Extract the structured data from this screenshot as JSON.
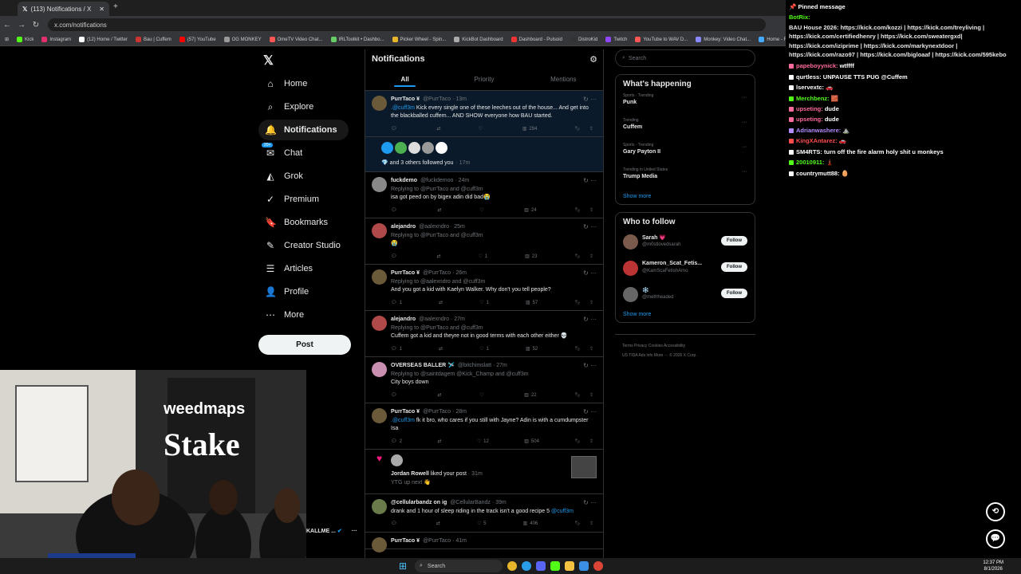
{
  "browser": {
    "tab_title": "(113) Notifications / X",
    "url": "x.com/notifications",
    "bookmarks": [
      "Kick",
      "Instagram",
      "(12) Home / Twitter",
      "Bau | Cuffem",
      "(57) YouTube",
      "OG MONKEY",
      "OmeTV Video Chat...",
      "IRLToolkit • Dashbo...",
      "Picker Wheel - Spin...",
      "KickBot Dashboard",
      "Dashboard - Pulsoid",
      "DistroKid",
      "Twitch",
      "YouTube to WAV D...",
      "Monkey: Video Chat...",
      "Home - Rob"
    ]
  },
  "nav": {
    "items": [
      "Home",
      "Explore",
      "Notifications",
      "Chat",
      "Grok",
      "Premium",
      "Bookmarks",
      "Creator Studio",
      "Articles",
      "Profile",
      "More"
    ],
    "chat_badge": "20+",
    "post_label": "Post"
  },
  "main": {
    "title": "Notifications",
    "tabs": [
      "All",
      "Priority",
      "Mentions"
    ],
    "posts": [
      {
        "name": "PurrTaco ¥",
        "handle": "@PurrTaco · 13m",
        "mention": ".@cuff3m",
        "text": " Kick every single one of these leeches out of the house... And get into the blackballed cuffem... AND SHOW everyone how BAU started.",
        "likes": "",
        "views": "284",
        "replies": "",
        "color": "#6b5a3a"
      },
      {
        "name": "fuckdemo",
        "handle": "@fuckdemoo · 24m",
        "reply_to": "Replying to @PurrTaco and @cuff3m",
        "text": "isa got peed on by bigex adin did bad😭",
        "likes": "",
        "views": "24",
        "replies": "",
        "color": "#888"
      },
      {
        "name": "alejandro",
        "handle": "@aalexndro · 25m",
        "reply_to": "Replying to @PurrTaco and @cuff3m",
        "text": "😭",
        "likes": "1",
        "views": "23",
        "replies": "",
        "color": "#b04a4a"
      },
      {
        "name": "PurrTaco ¥",
        "handle": "@PurrTaco · 26m",
        "reply_to": "Replying to @aalexndro and @cuff3m",
        "text": "And you got a kid with Kaelyn Walker. Why don't you tell people?",
        "likes": "1",
        "views": "57",
        "replies": "1",
        "color": "#6b5a3a"
      },
      {
        "name": "alejandro",
        "handle": "@aalexndro · 27m",
        "reply_to": "Replying to @PurrTaco and @cuff3m",
        "text": "Cuffem got a kid and theyre not in good terms with each other either 💀",
        "likes": "1",
        "views": "52",
        "replies": "1",
        "color": "#b04a4a"
      },
      {
        "name": "OVERSEAS BALLER 🛩️",
        "handle": "@bitchimslatt · 27m",
        "reply_to": "Replying to @saintdagem @Kick_Champ and @cuff3m",
        "text": "City boys down",
        "likes": "",
        "views": "22",
        "replies": "",
        "color": "#c98fb0"
      },
      {
        "name": "PurrTaco ¥",
        "handle": "@PurrTaco · 28m",
        "mention": ".@cuff3m",
        "text": " fk it bro, who cares if you still with Jayne? Adin is with a cumdumpster Isa",
        "likes": "12",
        "views": "504",
        "replies": "2",
        "color": "#6b5a3a"
      }
    ],
    "follow_notice": "and 3 others followed you",
    "follow_time": "· 17m",
    "like_notice_name": "Jordan Rowell",
    "like_notice_text": " liked your post",
    "like_notice_time": " · 31m",
    "like_notice_post": "YTG up next 👋",
    "last_post": {
      "name": "@cellularbandz on ig",
      "handle": "@CellularBandz · 39m",
      "text": "drank and 1 hour of sleep riding in the track isn't a good recipe 5 ",
      "mention": "@cuff3m",
      "likes": "5",
      "views": "406"
    },
    "cut_post": {
      "name": "PurrTaco ¥",
      "handle": "@PurrTaco · 41m"
    }
  },
  "right": {
    "search_placeholder": "Search",
    "whats_happening": "What's happening",
    "trends": [
      {
        "category": "Sports · Trending",
        "topic": "Punk"
      },
      {
        "category": "Trending",
        "topic": "Cuffem"
      },
      {
        "category": "Sports · Trending",
        "topic": "Gary Payton II"
      },
      {
        "category": "Trending in United States",
        "topic": "Trump Media"
      }
    ],
    "show_more": "Show more",
    "who_to_follow": "Who to follow",
    "follow_suggestions": [
      {
        "name": "Sarah 💗",
        "handle": "@m0stlovedsarah"
      },
      {
        "name": "Kameron_Scat_Fetis...",
        "handle": "@KamScaFetishAmo"
      },
      {
        "name": "❄️",
        "handle": "@methheaded"
      }
    ],
    "follow_label": "Follow",
    "footer_line1": "Terms   Privacy   Cookies   Accessibility",
    "footer_line2": "US TIDA   Ads info   More ···   © 2026 X Corp."
  },
  "chat": {
    "pinned_label": "Pinned message",
    "pinned_user": "BotRix:",
    "pinned_text": "BAU House 2026: https://kick.com/kozzi | https://kick.com/treyliving | https://kick.com/certifiedhenry | https://kick.com/sweatergxd| https://kick.com/iziprime | https://kick.com/markynextdoor | https://kick.com/razo97 | https://kick.com/bigloaaf | https://kick.com/595kebo",
    "messages": [
      {
        "user": "papeboyynick:",
        "text": " wtffff",
        "color": "#ff6b9d"
      },
      {
        "user": "qurtless:",
        "text": " UNPAUSE TTS PUG @Cuffem",
        "color": "#ffffff"
      },
      {
        "user": "lservextc:",
        "text": " 🚗",
        "color": "#ffffff"
      },
      {
        "user": "Merchbenz:",
        "text": " 🧱",
        "color": "#53fc18"
      },
      {
        "user": "upseting:",
        "text": " dude",
        "color": "#ff6b9d"
      },
      {
        "user": "upseting:",
        "text": " dude",
        "color": "#ff6b9d"
      },
      {
        "user": "Adrianwashere:",
        "text": " ⛰️",
        "color": "#b48cff"
      },
      {
        "user": "KingXAntarez:",
        "text": " 🚗",
        "color": "#ff4d4d"
      },
      {
        "user": "SM4RTS:",
        "text": " turn off the fire alarm holy shit u monkeys",
        "color": "#ffffff"
      },
      {
        "user": "20010911:",
        "text": " 🗼",
        "color": "#53fc18"
      },
      {
        "user": "countrymutt88:",
        "text": " 🥚",
        "color": "#ffffff"
      }
    ]
  },
  "stream": {
    "banner": "weedmaps",
    "stake": "Stake",
    "name_overlay": "KALLME ..."
  },
  "taskbar": {
    "search": "Search",
    "time": "12:37 PM",
    "date": "8/1/2026"
  }
}
